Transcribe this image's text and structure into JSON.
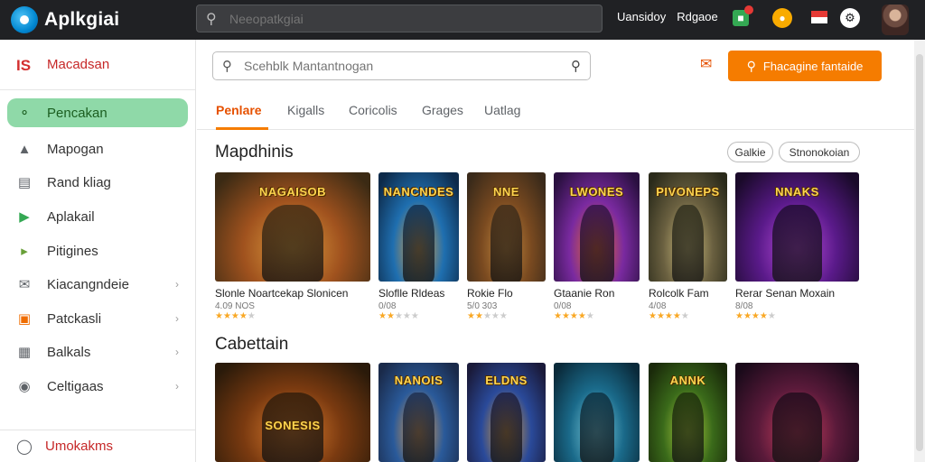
{
  "app": {
    "title": "Aplkgiai"
  },
  "topbar": {
    "search_placeholder": "Neeopatkgiai",
    "links": [
      "Uansidoy",
      "Rdgaoe"
    ],
    "icons": [
      "store-icon",
      "coin-icon",
      "flag-icon",
      "settings-icon"
    ]
  },
  "sidebar": {
    "header": "Macadsan",
    "items": [
      {
        "label": "Pencakan",
        "icon": "home-icon",
        "active": true,
        "chevron": false
      },
      {
        "label": "Mapogan",
        "icon": "store-icon",
        "active": false,
        "chevron": false
      },
      {
        "label": "Rand kliag",
        "icon": "document-icon",
        "active": false,
        "chevron": false
      },
      {
        "label": "Aplakail",
        "icon": "play-icon",
        "active": false,
        "chevron": false
      },
      {
        "label": "Pitigines",
        "icon": "tag-icon",
        "active": false,
        "chevron": false
      },
      {
        "label": "Kiacangndeie",
        "icon": "mail-icon",
        "active": false,
        "chevron": true
      },
      {
        "label": "Patckasli",
        "icon": "box-icon",
        "active": false,
        "chevron": true
      },
      {
        "label": "Balkals",
        "icon": "grid-icon",
        "active": false,
        "chevron": true
      },
      {
        "label": "Celtigaas",
        "icon": "location-icon",
        "active": false,
        "chevron": true
      }
    ],
    "footer": "Umokakms"
  },
  "main": {
    "search_placeholder": "Scehblk Mantantnogan",
    "cta_label": "Fhacagine fantaide",
    "tabs": [
      "Penlare",
      "Kigalls",
      "Coricolis",
      "Grages",
      "Uatlag"
    ],
    "section1": {
      "title": "Mapdhinis",
      "chips": [
        "Galkie",
        "Stnonokoian"
      ],
      "cards": [
        {
          "art": "NAGAISOB",
          "name": "Slonle Noartcekap Slonicen",
          "meta": "4.09 NOS",
          "rating": 4,
          "colors": [
            "#3b2a14",
            "#a0521e",
            "#e0a040"
          ]
        },
        {
          "art": "NANCNDES",
          "name": "Sloflle Rldeas",
          "meta": "0/08",
          "rating": 2,
          "colors": [
            "#0d2a4a",
            "#1f6fb0",
            "#f0a030"
          ]
        },
        {
          "art": "NNE",
          "name": "Rokie Flo",
          "meta": "5/0 303",
          "rating": 2,
          "colors": [
            "#3a2a1a",
            "#7a4a20",
            "#c48a40"
          ]
        },
        {
          "art": "LWONES",
          "name": "Gtaanie Ron",
          "meta": "0/08",
          "rating": 4,
          "colors": [
            "#2a1040",
            "#7a2aa0",
            "#f07020"
          ]
        },
        {
          "art": "PIVONEPS",
          "name": "Rolcolk Fam",
          "meta": "4/08",
          "rating": 4,
          "colors": [
            "#2a2a1a",
            "#6a6040",
            "#d0c080"
          ]
        },
        {
          "art": "NNAKS",
          "name": "Rerar Senan Moxain",
          "meta": "8/08",
          "rating": 4,
          "colors": [
            "#1a0a2a",
            "#5a1a8a",
            "#c050e0"
          ]
        }
      ]
    },
    "section2": {
      "title": "Cabettain",
      "cards": [
        {
          "art": "SONESIS",
          "colors": [
            "#2a1a0a",
            "#7a3a10",
            "#e08030"
          ]
        },
        {
          "art": "NANOIS",
          "colors": [
            "#1a2a4a",
            "#2a5a9a",
            "#f0a040"
          ]
        },
        {
          "art": "ELDNS",
          "colors": [
            "#1a1a3a",
            "#2a4a9a",
            "#e0a030"
          ]
        },
        {
          "art": "",
          "colors": [
            "#0a2a3a",
            "#1a6a8a",
            "#80d0e0"
          ]
        },
        {
          "art": "ANNK",
          "colors": [
            "#1a2a0a",
            "#3a6a1a",
            "#b0d040"
          ]
        },
        {
          "art": "",
          "colors": [
            "#1a0a1a",
            "#5a1a3a",
            "#d04060"
          ]
        }
      ]
    }
  }
}
